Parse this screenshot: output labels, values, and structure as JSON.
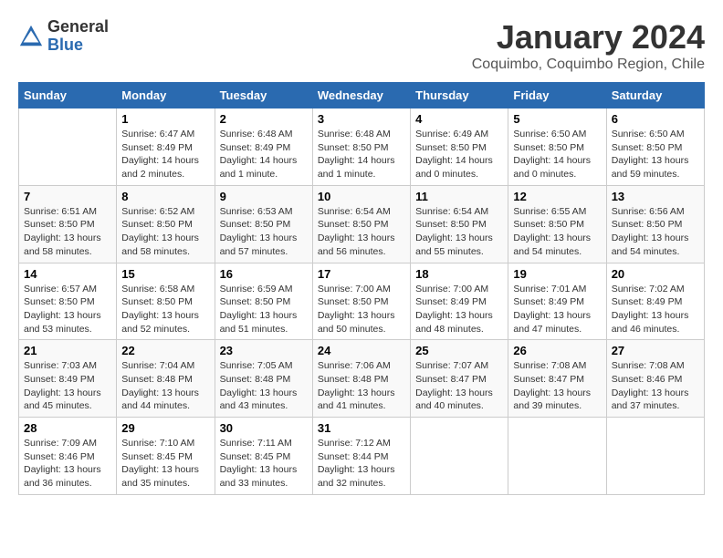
{
  "header": {
    "logo_general": "General",
    "logo_blue": "Blue",
    "month_title": "January 2024",
    "location": "Coquimbo, Coquimbo Region, Chile"
  },
  "weekdays": [
    "Sunday",
    "Monday",
    "Tuesday",
    "Wednesday",
    "Thursday",
    "Friday",
    "Saturday"
  ],
  "weeks": [
    [
      {
        "day": "",
        "info": ""
      },
      {
        "day": "1",
        "info": "Sunrise: 6:47 AM\nSunset: 8:49 PM\nDaylight: 14 hours\nand 2 minutes."
      },
      {
        "day": "2",
        "info": "Sunrise: 6:48 AM\nSunset: 8:49 PM\nDaylight: 14 hours\nand 1 minute."
      },
      {
        "day": "3",
        "info": "Sunrise: 6:48 AM\nSunset: 8:50 PM\nDaylight: 14 hours\nand 1 minute."
      },
      {
        "day": "4",
        "info": "Sunrise: 6:49 AM\nSunset: 8:50 PM\nDaylight: 14 hours\nand 0 minutes."
      },
      {
        "day": "5",
        "info": "Sunrise: 6:50 AM\nSunset: 8:50 PM\nDaylight: 14 hours\nand 0 minutes."
      },
      {
        "day": "6",
        "info": "Sunrise: 6:50 AM\nSunset: 8:50 PM\nDaylight: 13 hours\nand 59 minutes."
      }
    ],
    [
      {
        "day": "7",
        "info": "Sunrise: 6:51 AM\nSunset: 8:50 PM\nDaylight: 13 hours\nand 58 minutes."
      },
      {
        "day": "8",
        "info": "Sunrise: 6:52 AM\nSunset: 8:50 PM\nDaylight: 13 hours\nand 58 minutes."
      },
      {
        "day": "9",
        "info": "Sunrise: 6:53 AM\nSunset: 8:50 PM\nDaylight: 13 hours\nand 57 minutes."
      },
      {
        "day": "10",
        "info": "Sunrise: 6:54 AM\nSunset: 8:50 PM\nDaylight: 13 hours\nand 56 minutes."
      },
      {
        "day": "11",
        "info": "Sunrise: 6:54 AM\nSunset: 8:50 PM\nDaylight: 13 hours\nand 55 minutes."
      },
      {
        "day": "12",
        "info": "Sunrise: 6:55 AM\nSunset: 8:50 PM\nDaylight: 13 hours\nand 54 minutes."
      },
      {
        "day": "13",
        "info": "Sunrise: 6:56 AM\nSunset: 8:50 PM\nDaylight: 13 hours\nand 54 minutes."
      }
    ],
    [
      {
        "day": "14",
        "info": "Sunrise: 6:57 AM\nSunset: 8:50 PM\nDaylight: 13 hours\nand 53 minutes."
      },
      {
        "day": "15",
        "info": "Sunrise: 6:58 AM\nSunset: 8:50 PM\nDaylight: 13 hours\nand 52 minutes."
      },
      {
        "day": "16",
        "info": "Sunrise: 6:59 AM\nSunset: 8:50 PM\nDaylight: 13 hours\nand 51 minutes."
      },
      {
        "day": "17",
        "info": "Sunrise: 7:00 AM\nSunset: 8:50 PM\nDaylight: 13 hours\nand 50 minutes."
      },
      {
        "day": "18",
        "info": "Sunrise: 7:00 AM\nSunset: 8:49 PM\nDaylight: 13 hours\nand 48 minutes."
      },
      {
        "day": "19",
        "info": "Sunrise: 7:01 AM\nSunset: 8:49 PM\nDaylight: 13 hours\nand 47 minutes."
      },
      {
        "day": "20",
        "info": "Sunrise: 7:02 AM\nSunset: 8:49 PM\nDaylight: 13 hours\nand 46 minutes."
      }
    ],
    [
      {
        "day": "21",
        "info": "Sunrise: 7:03 AM\nSunset: 8:49 PM\nDaylight: 13 hours\nand 45 minutes."
      },
      {
        "day": "22",
        "info": "Sunrise: 7:04 AM\nSunset: 8:48 PM\nDaylight: 13 hours\nand 44 minutes."
      },
      {
        "day": "23",
        "info": "Sunrise: 7:05 AM\nSunset: 8:48 PM\nDaylight: 13 hours\nand 43 minutes."
      },
      {
        "day": "24",
        "info": "Sunrise: 7:06 AM\nSunset: 8:48 PM\nDaylight: 13 hours\nand 41 minutes."
      },
      {
        "day": "25",
        "info": "Sunrise: 7:07 AM\nSunset: 8:47 PM\nDaylight: 13 hours\nand 40 minutes."
      },
      {
        "day": "26",
        "info": "Sunrise: 7:08 AM\nSunset: 8:47 PM\nDaylight: 13 hours\nand 39 minutes."
      },
      {
        "day": "27",
        "info": "Sunrise: 7:08 AM\nSunset: 8:46 PM\nDaylight: 13 hours\nand 37 minutes."
      }
    ],
    [
      {
        "day": "28",
        "info": "Sunrise: 7:09 AM\nSunset: 8:46 PM\nDaylight: 13 hours\nand 36 minutes."
      },
      {
        "day": "29",
        "info": "Sunrise: 7:10 AM\nSunset: 8:45 PM\nDaylight: 13 hours\nand 35 minutes."
      },
      {
        "day": "30",
        "info": "Sunrise: 7:11 AM\nSunset: 8:45 PM\nDaylight: 13 hours\nand 33 minutes."
      },
      {
        "day": "31",
        "info": "Sunrise: 7:12 AM\nSunset: 8:44 PM\nDaylight: 13 hours\nand 32 minutes."
      },
      {
        "day": "",
        "info": ""
      },
      {
        "day": "",
        "info": ""
      },
      {
        "day": "",
        "info": ""
      }
    ]
  ]
}
